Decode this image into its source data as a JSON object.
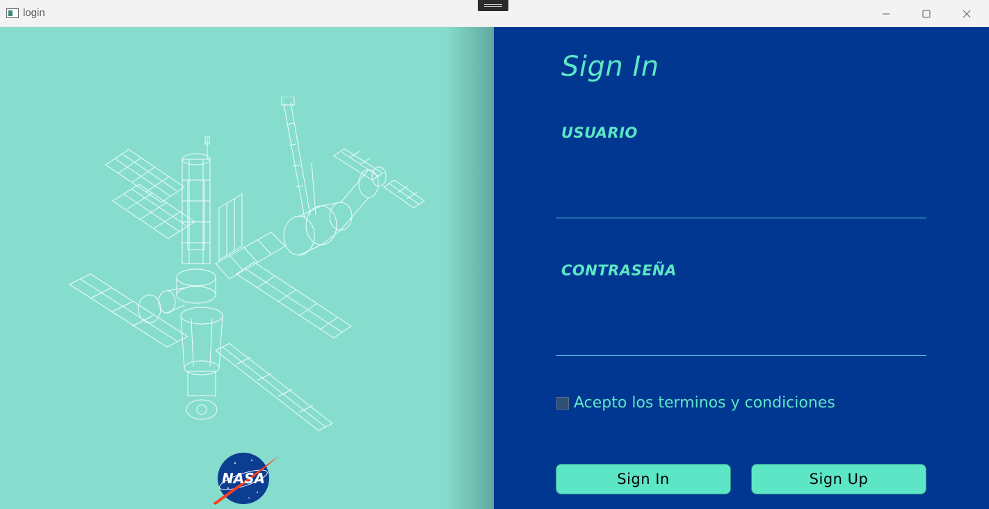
{
  "window": {
    "title": "login",
    "icons": {
      "app": "app-window-icon",
      "minimize": "minimize-icon",
      "maximize": "maximize-icon",
      "close": "close-icon"
    }
  },
  "left": {
    "illustration": "space-station-icon",
    "logo_text": "NASA"
  },
  "form": {
    "heading": "Sign In",
    "username_label": "USUARIO",
    "username_value": "",
    "password_label": "CONTRASEÑA",
    "password_value": "",
    "terms_label": "Acepto los terminos y condiciones",
    "terms_checked": false,
    "signin_label": "Sign In",
    "signup_label": "Sign Up"
  },
  "colors": {
    "left_bg": "#86ddcd",
    "right_bg": "#023791",
    "accent": "#5ce6c5",
    "input_line": "#5fd2e0"
  }
}
